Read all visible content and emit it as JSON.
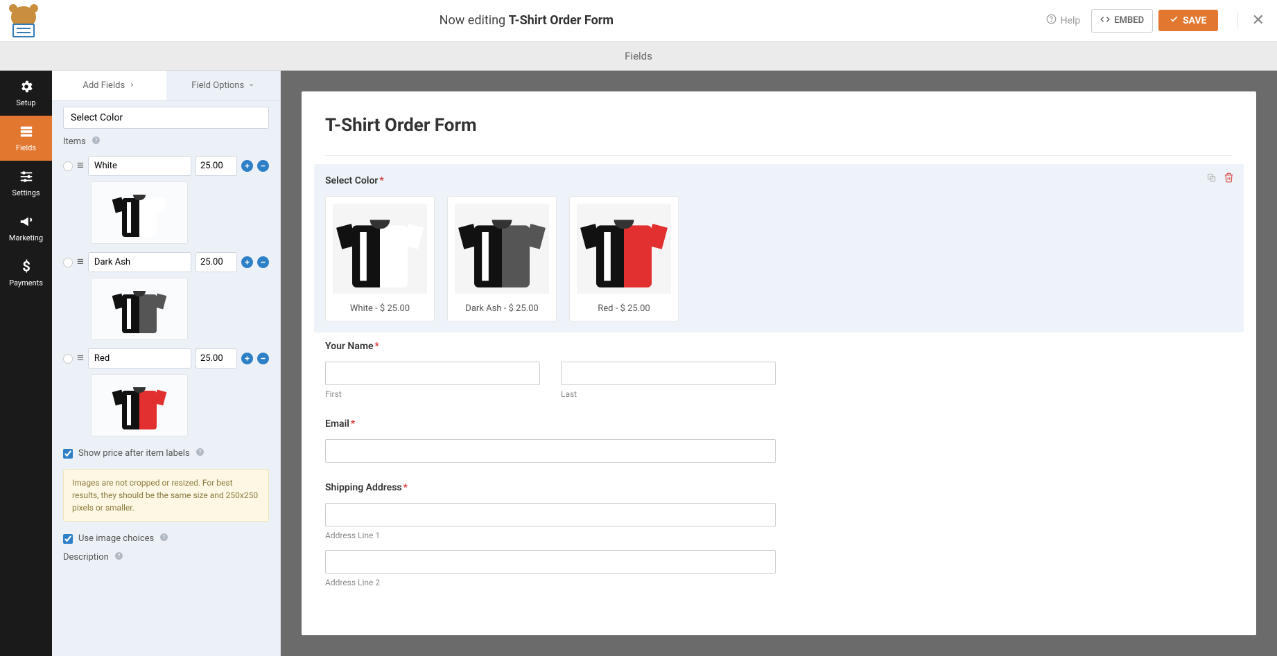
{
  "header": {
    "editing_prefix": "Now editing ",
    "editing_title": "T-Shirt Order Form",
    "help": "Help",
    "embed": "EMBED",
    "save": "SAVE"
  },
  "subheader": {
    "title": "Fields"
  },
  "left_nav": {
    "items": [
      {
        "label": "Setup",
        "icon": "gear"
      },
      {
        "label": "Fields",
        "icon": "fields"
      },
      {
        "label": "Settings",
        "icon": "sliders"
      },
      {
        "label": "Marketing",
        "icon": "horn"
      },
      {
        "label": "Payments",
        "icon": "dollar"
      }
    ]
  },
  "sidebar": {
    "tabs": {
      "add": "Add Fields",
      "options": "Field Options"
    },
    "label_value": "Select Color",
    "items_label": "Items",
    "items": [
      {
        "name": "White",
        "price": "25.00",
        "variant": "white"
      },
      {
        "name": "Dark Ash",
        "price": "25.00",
        "variant": "dark"
      },
      {
        "name": "Red",
        "price": "25.00",
        "variant": "red"
      }
    ],
    "show_price_label": "Show price after item labels",
    "notice": "Images are not cropped or resized. For best results, they should be the same size and 250x250 pixels or smaller.",
    "use_image_label": "Use image choices",
    "description_label": "Description"
  },
  "canvas": {
    "form_title": "T-Shirt Order Form",
    "select_color": {
      "label": "Select Color",
      "choices": [
        {
          "caption": "White - $ 25.00",
          "variant": "white"
        },
        {
          "caption": "Dark Ash - $ 25.00",
          "variant": "dark"
        },
        {
          "caption": "Red - $ 25.00",
          "variant": "red"
        }
      ]
    },
    "your_name": {
      "label": "Your Name",
      "first": "First",
      "last": "Last"
    },
    "email": {
      "label": "Email"
    },
    "address": {
      "label": "Shipping Address",
      "line1": "Address Line 1",
      "line2": "Address Line 2"
    }
  }
}
